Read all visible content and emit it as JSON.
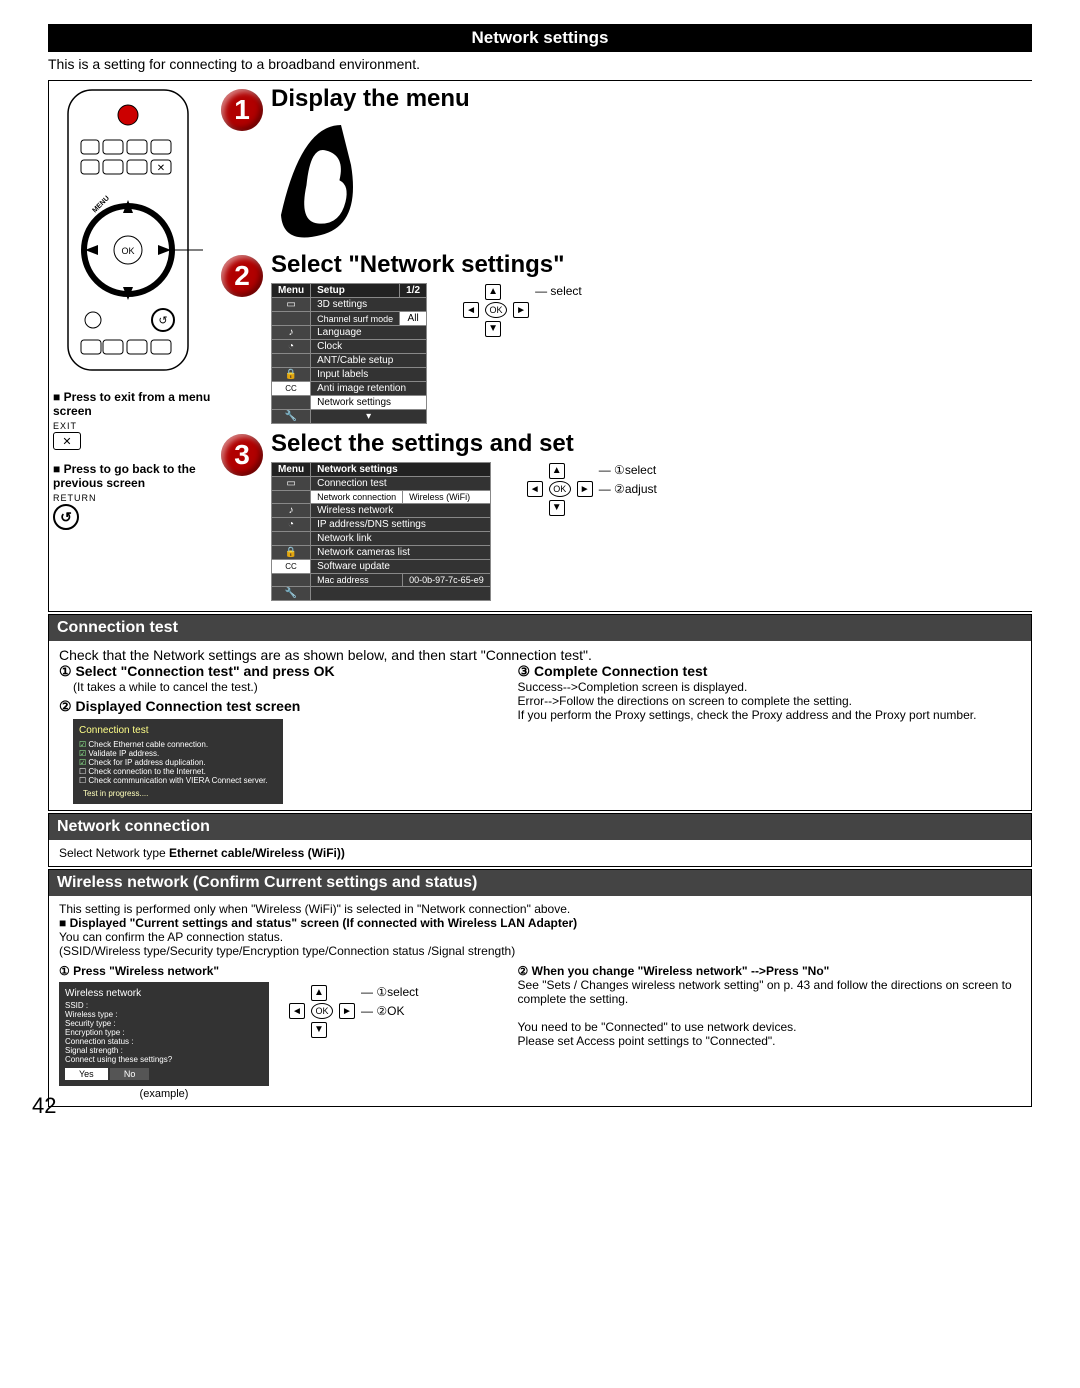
{
  "header": "Network settings",
  "intro": "This is a setting for connecting to a broadband environment.",
  "steps": {
    "s1": {
      "title": "Display the menu"
    },
    "s2": {
      "title": "Select \"Network settings\"",
      "lbl_select": "select",
      "menu_hdr_menu": "Menu",
      "menu_hdr_setup": "Setup",
      "menu_hdr_page": "1/2",
      "items": [
        "3D settings",
        "Channel surf mode",
        "Language",
        "Clock",
        "ANT/Cable setup",
        "Input labels",
        "Anti image retention",
        "Network settings"
      ],
      "all": "All"
    },
    "s3": {
      "title": "Select the settings and set",
      "lbl_select": "select",
      "lbl_adjust": "adjust",
      "menu_hdr_menu": "Menu",
      "menu_hdr_section": "Network settings",
      "items": [
        "Connection test",
        "Network connection",
        "Wireless network",
        "IP address/DNS settings",
        "Network link",
        "Network cameras list",
        "Software update",
        "Mac address"
      ],
      "netconn_value": "Wireless (WiFi)",
      "mac_value": "00-0b-97-7c-65-e9"
    }
  },
  "remote_instructions": {
    "exit_hdr": "■ Press to exit from a menu screen",
    "exit_label": "EXIT",
    "back_hdr": "■ Press to go back to the previous screen",
    "return_label": "RETURN"
  },
  "conn_test": {
    "header": "Connection test",
    "intro": "Check that the Network settings are as shown below, and then start \"Connection test\".",
    "step1_title": "Select \"Connection test\" and press OK",
    "step1_note": "(It takes a while to cancel the test.)",
    "step2_title": "Displayed Connection test screen",
    "box_title": "Connection test",
    "box_items": [
      "Check Ethernet cable connection.",
      "Validate IP address.",
      "Check for IP address duplication.",
      "Check connection to the Internet.",
      "Check communication with VIERA Connect server."
    ],
    "box_progress": "Test in progress....",
    "step3_title": "Complete Connection test",
    "success_line": "Success-->Completion screen is displayed.",
    "error_line": "Error-->Follow the directions on screen to complete the setting.",
    "proxy_line": "If you perform the Proxy settings, check the Proxy address and the Proxy port number."
  },
  "net_conn": {
    "header": "Network connection",
    "line1_pre": "Select Network type ",
    "line1_bold": "Ethernet cable/Wireless (WiFi))"
  },
  "wireless": {
    "header": "Wireless network (Confirm Current settings and status)",
    "intro": "This setting is performed only when \"Wireless (WiFi)\" is selected in \"Network connection\" above.",
    "disp_hdr": "■ Displayed \"Current settings and status\" screen (If connected with Wireless LAN Adapter)",
    "confirm": "You can confirm the AP connection status.",
    "line_fields": "(SSID/Wireless type/Security type/Encryption type/Connection status /Signal strength)",
    "step1_title": "Press \"Wireless network\"",
    "step2_title": "When you change \"Wireless network\" -->Press \"No\"",
    "step2_l1": "See \"Sets / Changes wireless network setting\" on p. 43 and follow the directions on screen to complete the setting.",
    "step2_l2": "You need to be \"Connected\" to use network devices.",
    "step2_l3": "Please set Access point settings to \"Connected\".",
    "box_title": "Wireless network",
    "box_fields": [
      "SSID :",
      "Wireless type :",
      "Security type :",
      "Encryption type :",
      "Connection status :",
      "Signal strength :",
      "Connect using these settings?"
    ],
    "yes": "Yes",
    "no": "No",
    "example": "(example)",
    "nav_select": "select",
    "nav_ok": "OK"
  },
  "page_number": "42",
  "enum": {
    "c1": "①",
    "c2": "②",
    "c3": "③"
  }
}
